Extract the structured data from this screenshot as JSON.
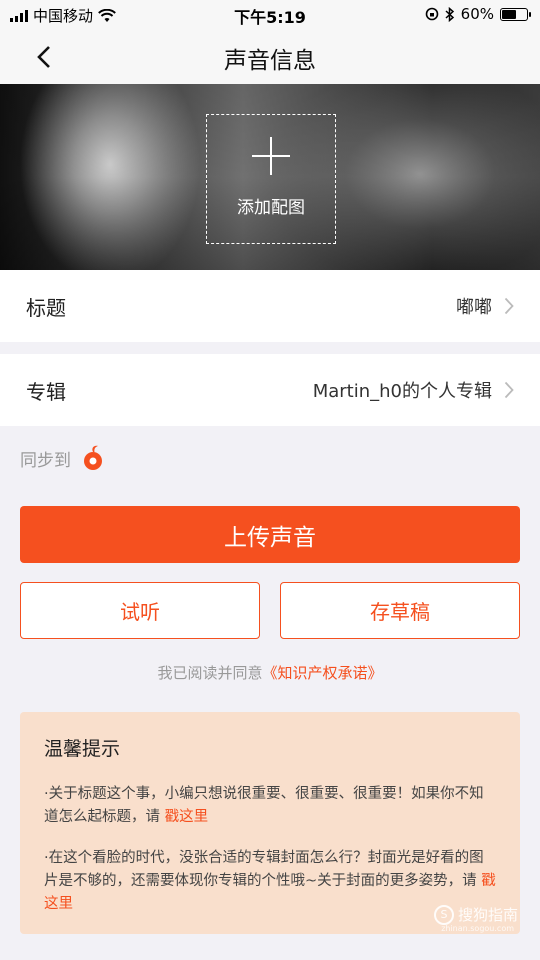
{
  "status_bar": {
    "carrier": "中国移动",
    "time": "下午5:19",
    "battery": "60%",
    "battery_level": 0.6
  },
  "nav": {
    "title": "声音信息"
  },
  "cover": {
    "add_label": "添加配图"
  },
  "rows": {
    "title_label": "标题",
    "title_value": "嘟嘟",
    "album_label": "专辑",
    "album_value": "Martin_h0的个人专辑"
  },
  "sync": {
    "label": "同步到"
  },
  "actions": {
    "upload": "上传声音",
    "preview": "试听",
    "save_draft": "存草稿"
  },
  "agreement": {
    "text": "我已阅读并同意",
    "link": "《知识产权承诺》"
  },
  "tips": {
    "title": "温馨提示",
    "tip1_text": "·关于标题这个事，小编只想说很重要、很重要、很重要！如果你不知道怎么起标题，请 ",
    "tip1_link": "戳这里",
    "tip2_text": "·在这个看脸的时代，没张合适的专辑封面怎么行？封面光是好看的图片是不够的，还需要体现你专辑的个性哦~关于封面的更多姿势，请 ",
    "tip2_link": "戳这里"
  },
  "watermark": {
    "text": "搜狗指南",
    "sub": "zhinan.sogou.com"
  },
  "colors": {
    "accent": "#f5501f",
    "tips_bg": "#f9dfcc",
    "page_bg": "#f2f1f6"
  }
}
